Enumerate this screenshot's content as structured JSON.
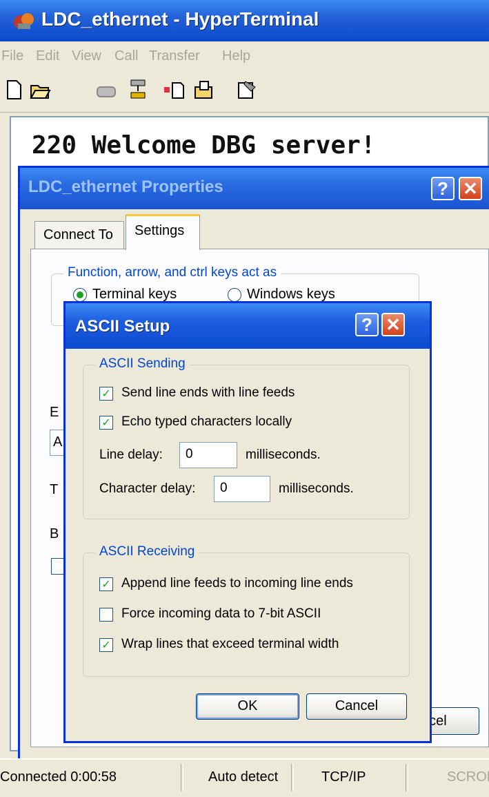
{
  "main_window": {
    "title": "LDC_ethernet - HyperTerminal",
    "menu": [
      "File",
      "Edit",
      "View",
      "Call",
      "Transfer",
      "Help"
    ],
    "toolbar_icons": [
      "new-icon",
      "open-icon",
      "phone-icon",
      "disconnect-icon",
      "send-icon",
      "receive-icon",
      "properties-icon"
    ],
    "terminal_text": "220 Welcome DBG server!",
    "status": {
      "connected": "Connected 0:00:58",
      "detect": "Auto detect",
      "protocol": "TCP/IP",
      "scroll": "SCROL"
    }
  },
  "properties_dialog": {
    "title": "LDC_ethernet Properties",
    "help_glyph": "?",
    "close_glyph": "✕",
    "tabs": [
      {
        "label": "Connect To",
        "active": false
      },
      {
        "label": "Settings",
        "active": true
      }
    ],
    "fkeys_group": {
      "legend": "Function, arrow, and ctrl keys act as",
      "options": [
        {
          "label": "Terminal keys",
          "selected": true
        },
        {
          "label": "Windows keys",
          "selected": false
        }
      ]
    },
    "partial_labels": [
      "E",
      "A",
      "T",
      "B"
    ],
    "cancel_partial": "ncel"
  },
  "ascii_dialog": {
    "title": "ASCII Setup",
    "help_glyph": "?",
    "close_glyph": "✕",
    "sending": {
      "legend": "ASCII Sending",
      "options": [
        {
          "label": "Send line ends with line feeds",
          "checked": true
        },
        {
          "label": "Echo typed characters locally",
          "checked": true
        }
      ],
      "line_delay": {
        "label": "Line delay:",
        "value": "0",
        "unit": "milliseconds."
      },
      "char_delay": {
        "label": "Character delay:",
        "value": "0",
        "unit": "milliseconds."
      }
    },
    "receiving": {
      "legend": "ASCII Receiving",
      "options": [
        {
          "label": "Append line feeds to incoming line ends",
          "checked": true
        },
        {
          "label": "Force incoming data to 7-bit ASCII",
          "checked": false
        },
        {
          "label": "Wrap lines that exceed terminal width",
          "checked": true
        }
      ]
    },
    "buttons": {
      "ok": "OK",
      "cancel": "Cancel"
    }
  },
  "colors": {
    "title_blue": "#0a49c9",
    "group_label": "#0046d5",
    "check_green": "#21a121",
    "close_red": "#d3401b"
  }
}
